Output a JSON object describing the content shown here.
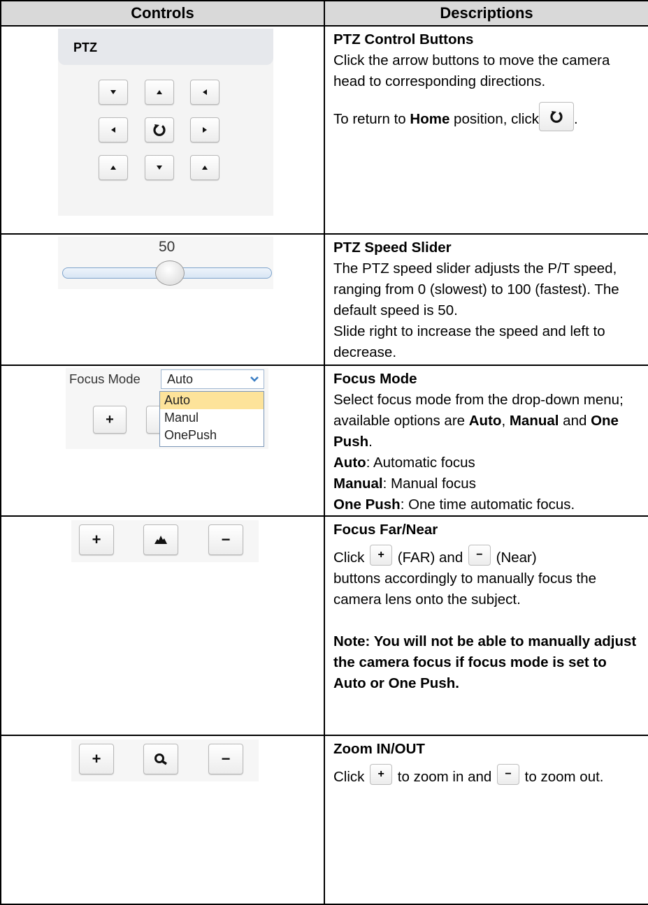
{
  "headers": {
    "controls": "Controls",
    "descriptions": "Descriptions"
  },
  "ptz": {
    "panel_title": "PTZ",
    "desc_title": "PTZ Control Buttons",
    "desc_text": "Click the arrow buttons to move the camera head to corresponding directions.",
    "home_pre": "To return to ",
    "home_word": "Home",
    "home_post": " position, click",
    "home_end": ".",
    "buttons": [
      "up-left",
      "up",
      "up-right",
      "left",
      "home",
      "right",
      "down-left",
      "down",
      "down-right"
    ]
  },
  "speed": {
    "value_label": "50",
    "value": 50,
    "min": 0,
    "max": 100,
    "desc_title": "PTZ Speed Slider",
    "desc_text": "The PTZ speed slider adjusts the P/T speed, ranging from 0 (slowest) to 100 (fastest). The default speed is 50.",
    "desc_text2": "Slide right to increase the speed and left to decrease."
  },
  "focus_mode": {
    "label": "Focus Mode",
    "selected": "Auto",
    "options": [
      "Auto",
      "Manul",
      "OnePush"
    ],
    "plus": "+",
    "desc_title": "Focus Mode",
    "desc_line1_pre": "Select focus mode from the drop-down menu; available options are ",
    "opt_auto": "Auto",
    "comma": ",",
    "opt_manual": "Manual",
    "and": " and ",
    "opt_onepush": "One Push",
    "period": ".",
    "def_auto_k": "Auto",
    "def_auto_v": ": Automatic focus",
    "def_manual_k": "Manual",
    "def_manual_v": ": Manual focus",
    "def_onepush_k": "One Push",
    "def_onepush_v": ": One time automatic focus."
  },
  "focus_far_near": {
    "plus": "+",
    "minus": "−",
    "desc_title": "Focus Far/Near",
    "click": "Click ",
    "far": " (FAR) and ",
    "near": " (Near)",
    "desc_text": "buttons accordingly to manually focus the camera lens onto the subject.",
    "note": "Note: You will not be able to manually adjust the camera focus if focus mode is set to Auto or One Push."
  },
  "zoom": {
    "plus": "+",
    "minus": "−",
    "desc_title": "Zoom IN/OUT",
    "click": "Click ",
    "zoom_in": " to zoom in and ",
    "zoom_out": " to zoom out."
  }
}
